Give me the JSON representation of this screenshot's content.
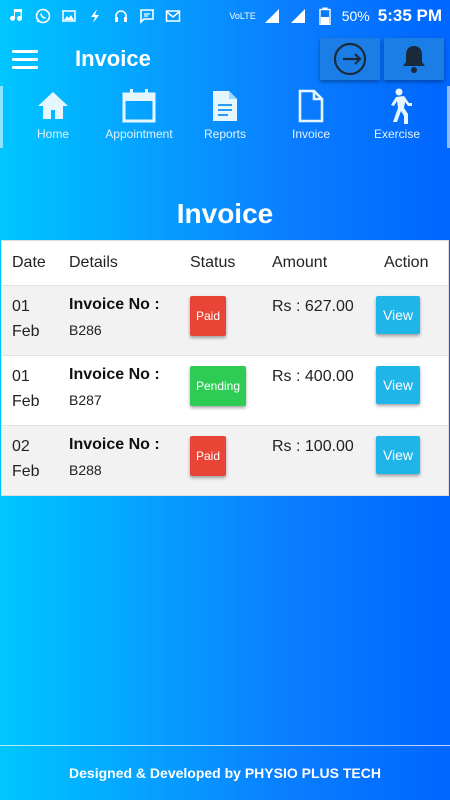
{
  "status_bar": {
    "network_label": "VoLTE",
    "battery_percent": "50%",
    "time": "5:35 PM",
    "icons": [
      "music-icon",
      "whatsapp-icon",
      "image-icon",
      "flash-icon",
      "headset-icon",
      "message-icon",
      "gmail-icon",
      "signal-icon",
      "battery-icon"
    ]
  },
  "app_bar": {
    "title": "Invoice",
    "actions": [
      "logout-icon",
      "bell-icon"
    ]
  },
  "tabs": [
    {
      "label": "Home",
      "icon": "home-icon"
    },
    {
      "label": "Appointment",
      "icon": "calendar-icon"
    },
    {
      "label": "Reports",
      "icon": "report-icon"
    },
    {
      "label": "Invoice",
      "icon": "document-icon"
    },
    {
      "label": "Exercise",
      "icon": "walking-icon"
    }
  ],
  "page": {
    "heading": "Invoice"
  },
  "table": {
    "headers": {
      "date": "Date",
      "details": "Details",
      "status": "Status",
      "amount": "Amount",
      "action": "Action"
    },
    "rows": [
      {
        "day": "01",
        "month": "Feb",
        "details_label": "Invoice No :",
        "invoice_no": "B286",
        "status": "Paid",
        "amount": "Rs : 627.00",
        "action": "View"
      },
      {
        "day": "01",
        "month": "Feb",
        "details_label": "Invoice No :",
        "invoice_no": "B287",
        "status": "Pending",
        "amount": "Rs : 400.00",
        "action": "View"
      },
      {
        "day": "02",
        "month": "Feb",
        "details_label": "Invoice No :",
        "invoice_no": "B288",
        "status": "Paid",
        "amount": "Rs : 100.00",
        "action": "View"
      }
    ]
  },
  "footer": {
    "text": "Designed & Developed by PHYSIO PLUS TECH"
  },
  "colors": {
    "paid": "#e94536",
    "pending": "#2ecc55",
    "view_button": "#1fb5e8",
    "background_start": "#00c6ff",
    "background_end": "#0066ff"
  }
}
